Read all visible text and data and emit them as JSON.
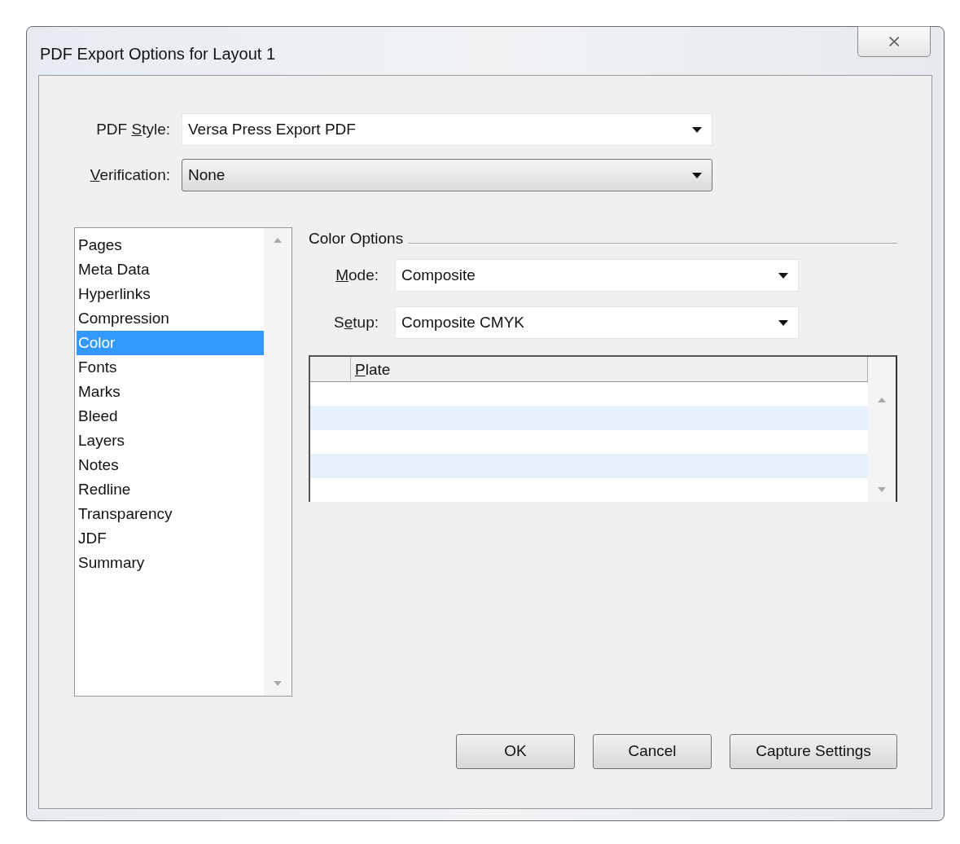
{
  "window": {
    "title": "PDF Export Options for Layout 1",
    "close": "⨯"
  },
  "style": {
    "label": {
      "pre": "PDF ",
      "key": "S",
      "post": "tyle:"
    },
    "value": "Versa Press Export PDF"
  },
  "verification": {
    "label": {
      "key": "V",
      "post": "erification:"
    },
    "value": "None"
  },
  "sections": [
    {
      "label": "Pages",
      "selected": false
    },
    {
      "label": "Meta Data",
      "selected": false
    },
    {
      "label": "Hyperlinks",
      "selected": false
    },
    {
      "label": "Compression",
      "selected": false
    },
    {
      "label": "Color",
      "selected": true
    },
    {
      "label": "Fonts",
      "selected": false
    },
    {
      "label": "Marks",
      "selected": false
    },
    {
      "label": "Bleed",
      "selected": false
    },
    {
      "label": "Layers",
      "selected": false
    },
    {
      "label": "Notes",
      "selected": false
    },
    {
      "label": "Redline",
      "selected": false
    },
    {
      "label": "Transparency",
      "selected": false
    },
    {
      "label": "JDF",
      "selected": false
    },
    {
      "label": "Summary",
      "selected": false
    }
  ],
  "color_options": {
    "title": "Color Options",
    "mode": {
      "label": {
        "key": "M",
        "post": "ode:"
      },
      "value": "Composite"
    },
    "setup": {
      "label": {
        "pre": "S",
        "key": "e",
        "post": "tup:"
      },
      "value": "Composite CMYK"
    },
    "table": {
      "columns": [
        {
          "key": "P",
          "post": "late"
        }
      ]
    }
  },
  "buttons": [
    "OK",
    "Cancel",
    "Capture Settings"
  ]
}
